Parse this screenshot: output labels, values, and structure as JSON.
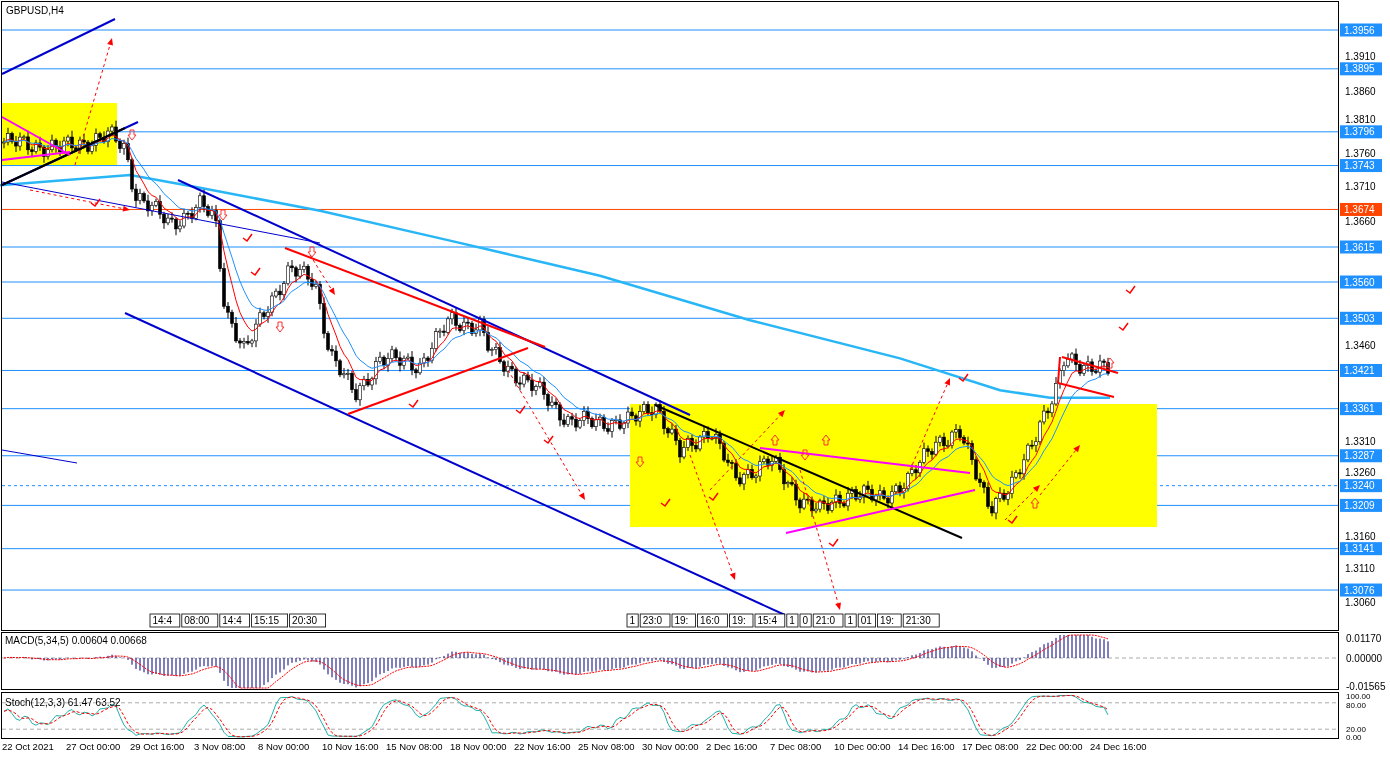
{
  "chart": {
    "title": "GBPUSD,H4",
    "price_levels": [
      {
        "label": "1.3956",
        "color": "#1e90ff",
        "dashed": false
      },
      {
        "label": "1.3895",
        "color": "#1e90ff",
        "dashed": false
      },
      {
        "label": "1.3796",
        "color": "#1e90ff",
        "dashed": false
      },
      {
        "label": "1.3743",
        "color": "#1e90ff",
        "dashed": false
      },
      {
        "label": "1.3674",
        "color": "#ff4500",
        "dashed": false
      },
      {
        "label": "1.3615",
        "color": "#1e90ff",
        "dashed": false
      },
      {
        "label": "1.3560",
        "color": "#1e90ff",
        "dashed": false
      },
      {
        "label": "1.3503",
        "color": "#1e90ff",
        "dashed": false
      },
      {
        "label": "1.3421",
        "color": "#1e90ff",
        "dashed": false
      },
      {
        "label": "1.3361",
        "color": "#1e90ff",
        "dashed": false
      },
      {
        "label": "1.3287",
        "color": "#1e90ff",
        "dashed": false
      },
      {
        "label": "1.3240",
        "color": "#1e90ff",
        "dashed": true
      },
      {
        "label": "1.3209",
        "color": "#1e90ff",
        "dashed": false
      },
      {
        "label": "1.3141",
        "color": "#1e90ff",
        "dashed": false
      },
      {
        "label": "1.3076",
        "color": "#1e90ff",
        "dashed": false
      }
    ],
    "price_ticks": [
      "1.3910",
      "1.3860",
      "1.3810",
      "1.3760",
      "1.3710",
      "1.3660",
      "1.3460",
      "1.3310",
      "1.3260",
      "1.3160",
      "1.3110",
      "1.3060"
    ],
    "session_groups": [
      {
        "labels": [
          "14:4",
          "08:00",
          "14:4",
          "15:15",
          "20:30"
        ]
      },
      {
        "labels": [
          "1",
          "23:0",
          "19:",
          "16:0",
          "19:",
          "15:4",
          "1",
          "0",
          "21:0",
          "1",
          "01",
          "19:",
          "21:30"
        ]
      }
    ],
    "time_labels": [
      "22 Oct 2021",
      "27 Oct 00:00",
      "29 Oct 16:00",
      "3 Nov 08:00",
      "8 Nov 00:00",
      "10 Nov 16:00",
      "15 Nov 08:00",
      "18 Nov 00:00",
      "22 Nov 16:00",
      "25 Nov 08:00",
      "30 Nov 00:00",
      "2 Dec 16:00",
      "7 Dec 08:00",
      "10 Dec 00:00",
      "14 Dec 16:00",
      "17 Dec 08:00",
      "22 Dec 00:00",
      "24 Dec 16:00"
    ],
    "macd": {
      "label": "MACD(5,34,5) 0.00604 0.00668",
      "ticks": [
        "0.01170",
        "0.00000",
        "-0.01565"
      ]
    },
    "stoch": {
      "label": "Stoch(12,3,3) 61.47 63.52",
      "ticks": [
        "100.00",
        "80.00",
        "20.00",
        "0.00"
      ]
    }
  }
}
